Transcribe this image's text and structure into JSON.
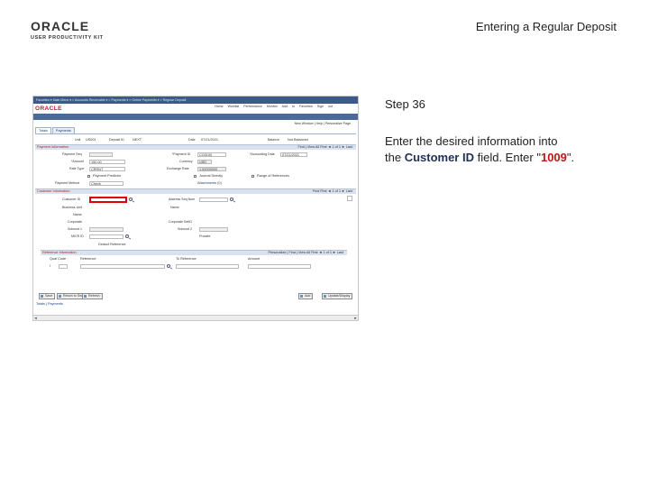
{
  "slide": {
    "logo_word": "ORACLE",
    "logo_sub": "USER PRODUCTIVITY KIT",
    "title": "Entering a Regular Deposit"
  },
  "instructions": {
    "step": "Step 36",
    "line1": "Enter the desired information into",
    "line2_pre": "the ",
    "field_name": "Customer ID",
    "line2_mid": " field. Enter \"",
    "value": "1009",
    "line2_post": "\"."
  },
  "app": {
    "breadcrumb": "Favorites ▾  Main Menu ▾  > Accounts Receivable ▾  > Payments ▾  > Online Payments ▾  > Regular Deposit",
    "logo": "ORACLE",
    "nav_links": "Home   Worklist   Performance Monitor   Add to Favorites   Sign out",
    "new_window": "New Window | Help | Personalize Page",
    "tabs": [
      "Totals",
      "Payments"
    ],
    "header_row": {
      "unit_label": "Unit",
      "unit_value": "US001",
      "deposit_label": "Deposit ID",
      "deposit_value": "NEXT",
      "date_label": "Date",
      "date_value": "07/21/2021",
      "balance_label": "Balance",
      "balance_value": "Not Balanced"
    },
    "payment_info": {
      "header": "Payment Information",
      "nav": "Find | View All   First ◄ 1 of 1 ► Last",
      "payment_seq_label": "Payment Seq",
      "payment_id_label": "*Payment ID",
      "payment_id_value": "CO0100",
      "accounting_date_label": "*Accounting Date",
      "accounting_date_value": "07/21/2021",
      "amount_label": "*Amount",
      "amount_value": "150.00",
      "currency_label": "Currency",
      "currency_value": "USD",
      "rate_type_label": "Rate Type",
      "rate_type_value": "CRRNT",
      "exchange_rate_label": "Exchange Rate",
      "exchange_rate_value": "1.00000000",
      "payment_predictor_label": "Payment Predictor",
      "journal_directly_label": "Journal Directly",
      "range_of_references_label": "Range of References",
      "payment_method_label": "Payment Method",
      "payment_method_value": "Check",
      "attachments_label": "Attachments (0)"
    },
    "customer_info": {
      "header": "Customer Information",
      "nav": "Find   First ◄ 1 of 1 ► Last",
      "customer_id_label": "Customer ID",
      "address_seq_label": "Address Seq Num",
      "business_unit_label": "Business Unit",
      "name_label": "Name",
      "name2_label": "Name",
      "corporate_label": "Corporate",
      "corporate_setid_label": "Corporate SetID",
      "subcustomer1_label": "Subcust 1",
      "subcustomer2_label": "Subcust 2",
      "micr_label": "MICR ID",
      "prorate_label": "Prorate",
      "ref_info_label": "Deduct Reference"
    },
    "reference_info": {
      "header": "Reference Information",
      "nav": "Personalize | Find | View All   First ◄ 1 of 1 ► Last",
      "col_qual": "Qual Code",
      "col_ref": "Reference",
      "col_to": "To Reference",
      "col_amount": "Amount",
      "row_qual": "I"
    },
    "buttons": {
      "save": "Save",
      "return": "Return to Search",
      "refresh": "Refresh",
      "add": "Add",
      "update": "Update/Display"
    },
    "footer_tabs": "Totals | Payments"
  }
}
